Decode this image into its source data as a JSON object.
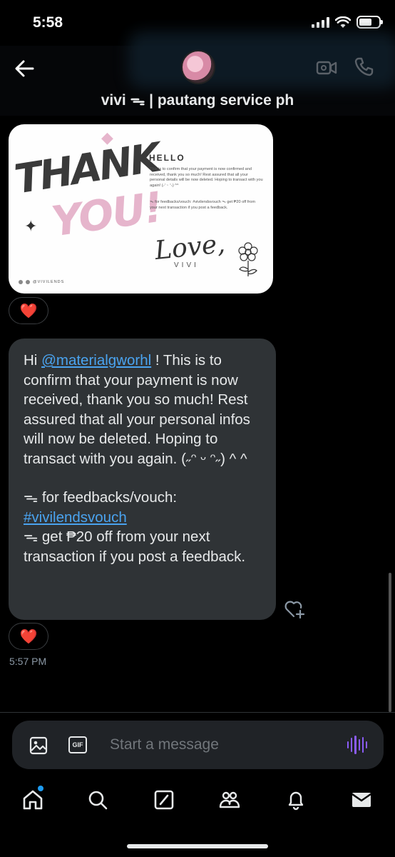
{
  "status_bar": {
    "time": "5:58",
    "battery_level": 0.65
  },
  "header": {
    "back_icon": "arrow-left-icon",
    "title": "vivi ᯓ | pautang service ph",
    "video_icon": "video-camera-icon",
    "call_icon": "phone-icon"
  },
  "image_card": {
    "thank": "THANK",
    "you": "YOU!",
    "hello": "HELLO",
    "body": "This is to confirm that your payment is now confirmed and received, thank you so much! Rest assured that all your personal details will be now deleted. Hoping to transact with you again! (˶ᵔ ᵕ ᵔ˶) ^^",
    "feedback": "ᯓ for feedbacks/vouch: #vivilendsvouch ᯓ get ₱20 off from your next transaction if you post a feedback.",
    "love": "Love,",
    "signature": "VIVI",
    "handle": "@VIVILENDS"
  },
  "reaction_1": "❤️",
  "message": {
    "line_intro": "Hi ",
    "mention": "@materialgworhl",
    "line_rest": " ! This is to confirm that your payment is now received, thank you so much! Rest assured that all your personal infos will now be deleted. Hoping to transact with you again.  (˶ᵔ ᵕ ᵔ˶) ^ ^",
    "feedback_label": "ᯓ for feedbacks/vouch:",
    "hashtag": "#vivilendsvouch",
    "discount": "ᯓ get ₱20 off from your next transaction if you post a feedback."
  },
  "reaction_2": "❤️",
  "add_reaction_icon": "heart-plus-icon",
  "timestamp": "5:57 PM",
  "composer": {
    "placeholder": "Start a message",
    "image_icon": "image-icon",
    "gif_label": "GIF",
    "voice_icon": "voice-wave-icon",
    "voice_color": "#8b5cf6"
  },
  "bottom_nav": {
    "items": [
      "home-icon",
      "search-icon",
      "grok-icon",
      "communities-icon",
      "notifications-icon",
      "messages-icon"
    ],
    "accent": "#1d9bf0"
  }
}
